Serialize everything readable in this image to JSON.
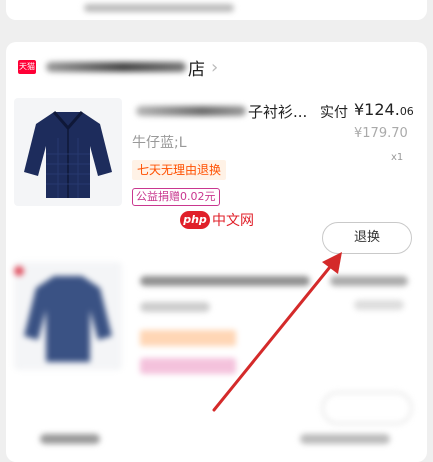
{
  "store": {
    "badge": "天猫",
    "name_suffix": "店"
  },
  "item1": {
    "title_tail": "子衬衫...",
    "paid_label": "实付",
    "paid_price_main": "¥124.",
    "paid_price_cents": "06",
    "original_price": "¥179.70",
    "sku": "牛仔蓝;L",
    "quantity": "x1",
    "return_tag": "七天无理由退换",
    "charity_tag": "公益捐赠0.02元",
    "action_label": "退换"
  },
  "watermark": {
    "php": "php",
    "text": "中文网"
  },
  "colors": {
    "accent": "#ff5000",
    "tmall_red": "#ff0036",
    "arrow_red": "#d42a2a"
  }
}
